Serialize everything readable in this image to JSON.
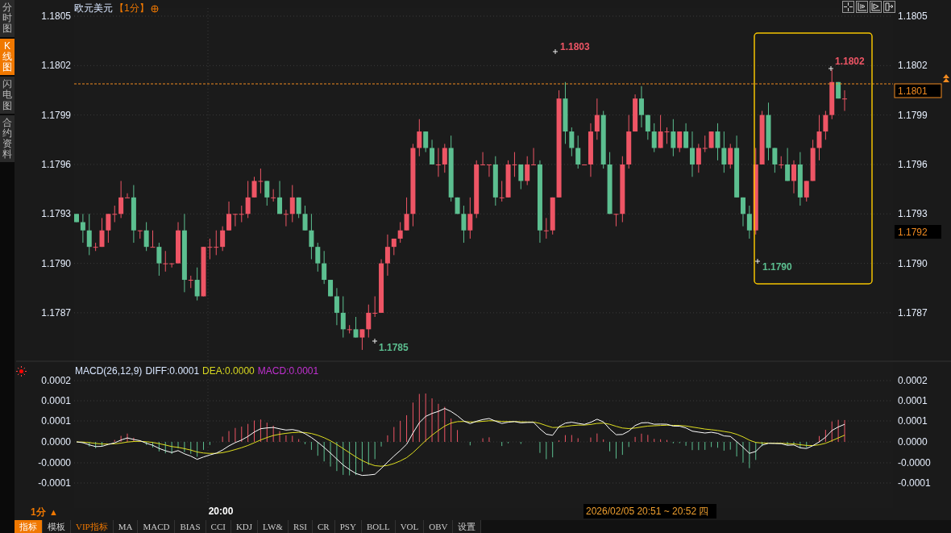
{
  "sidebar": {
    "tabs": [
      {
        "label": "分时图",
        "selected": false
      },
      {
        "label": "K线图",
        "selected": true
      },
      {
        "label": "闪电图",
        "selected": false
      },
      {
        "label": "合约资料",
        "selected": false
      }
    ]
  },
  "chart": {
    "title": "欧元美元",
    "period": "【1分】",
    "left_axis": [
      "1.1805",
      "1.1802",
      "1.1799",
      "1.1796",
      "1.1793",
      "1.1790",
      "1.1787"
    ],
    "right_axis": [
      "1.1805",
      "1.1802",
      "1.1799",
      "1.1796",
      "1.1793",
      "1.1790",
      "1.1787"
    ],
    "markers": [
      {
        "label": "1.1803",
        "kind": "high"
      },
      {
        "label": "1.1785",
        "kind": "low"
      },
      {
        "label": "1.1790",
        "kind": "low"
      },
      {
        "label": "1.1802",
        "kind": "high"
      }
    ],
    "last_price": "1.1801",
    "cursor_price": "1.1792"
  },
  "macd": {
    "header": "MACD(26,12,9)",
    "diff": "DIFF:0.0001",
    "dea": "DEA:0.0000",
    "macd": "MACD:0.0001",
    "left_axis": [
      "0.0002",
      "0.0001",
      "0.0001",
      "0.0000",
      "-0.0000",
      "-0.0001"
    ],
    "right_axis": [
      "0.0002",
      "0.0001",
      "0.0001",
      "0.0000",
      "-0.0000",
      "-0.0001"
    ]
  },
  "time_axis": {
    "period": "1分",
    "caret": "▲",
    "label": "20:00",
    "tooltip": "2026/02/05 20:51 ~ 20:52 四"
  },
  "bottom_tabs": [
    {
      "label": "指标",
      "selected": true,
      "kind": "plain"
    },
    {
      "label": "模板",
      "selected": false,
      "kind": "plain"
    },
    {
      "label": "VIP指标",
      "selected": false,
      "kind": "vip"
    },
    {
      "label": "MA",
      "selected": false,
      "kind": "plain"
    },
    {
      "label": "MACD",
      "selected": false,
      "kind": "plain"
    },
    {
      "label": "BIAS",
      "selected": false,
      "kind": "plain"
    },
    {
      "label": "CCI",
      "selected": false,
      "kind": "plain"
    },
    {
      "label": "KDJ",
      "selected": false,
      "kind": "plain"
    },
    {
      "label": "LW&",
      "selected": false,
      "kind": "plain"
    },
    {
      "label": "RSI",
      "selected": false,
      "kind": "plain"
    },
    {
      "label": "CR",
      "selected": false,
      "kind": "plain"
    },
    {
      "label": "PSY",
      "selected": false,
      "kind": "plain"
    },
    {
      "label": "BOLL",
      "selected": false,
      "kind": "plain"
    },
    {
      "label": "VOL",
      "selected": false,
      "kind": "plain"
    },
    {
      "label": "OBV",
      "selected": false,
      "kind": "plain"
    },
    {
      "label": "设置",
      "selected": false,
      "kind": "plain"
    }
  ]
}
